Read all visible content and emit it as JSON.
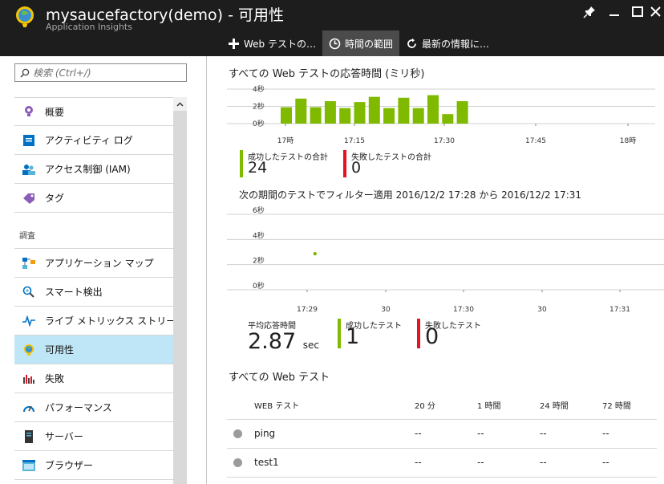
{
  "header": {
    "title": "mysaucefactory(demo) - 可用性",
    "subtitle": "Application Insights",
    "commands": [
      {
        "label": "Web テストの…",
        "icon": "plus-icon"
      },
      {
        "label": "時間の範囲",
        "icon": "clock-icon"
      },
      {
        "label": "最新の情報に…",
        "icon": "refresh-icon"
      }
    ],
    "window_buttons": [
      "pin-icon",
      "minimize-icon",
      "maximize-icon",
      "close-icon"
    ]
  },
  "sidebar": {
    "search_placeholder": "検索 (Ctrl+/)",
    "items": [
      {
        "label": "概要",
        "icon": "lightbulb-icon"
      },
      {
        "label": "アクティビティ ログ",
        "icon": "activity-log-icon"
      },
      {
        "label": "アクセス制御 (IAM)",
        "icon": "users-icon"
      },
      {
        "label": "タグ",
        "icon": "tag-icon"
      }
    ],
    "section_label": "調査",
    "section_items": [
      {
        "label": "アプリケーション マップ",
        "icon": "app-map-icon"
      },
      {
        "label": "スマート検出",
        "icon": "smart-detection-icon"
      },
      {
        "label": "ライブ メトリックス ストリーム",
        "icon": "live-metrics-icon"
      },
      {
        "label": "可用性",
        "icon": "globe-icon"
      },
      {
        "label": "失敗",
        "icon": "failures-chart-icon"
      },
      {
        "label": "パフォーマンス",
        "icon": "performance-icon"
      },
      {
        "label": "サーバー",
        "icon": "server-icon"
      },
      {
        "label": "ブラウザー",
        "icon": "browser-icon"
      }
    ]
  },
  "main": {
    "response_chart_title": "すべての Web テストの応答時間 (ミリ秒)",
    "totals": {
      "passed_label": "成功したテストの合計",
      "passed_value": "24",
      "failed_label": "失敗したテストの合計",
      "failed_value": "0"
    },
    "filter_text": "次の期間のテストでフィルター適用 2016/12/2 17:28 から 2016/12/2 17:31",
    "period": {
      "avg_label": "平均応答時間",
      "avg_value": "2.87",
      "avg_unit": "sec",
      "passed_label": "成功したテスト",
      "passed_value": "1",
      "failed_label": "失敗したテスト",
      "failed_value": "0"
    },
    "web_tests_title": "すべての Web テスト",
    "table": {
      "headers": [
        "WEB テスト",
        "20 分",
        "1 時間",
        "24 時間",
        "72 時間"
      ],
      "rows": [
        {
          "name": "ping",
          "cells": [
            "--",
            "--",
            "--",
            "--"
          ]
        },
        {
          "name": "test1",
          "cells": [
            "--",
            "--",
            "--",
            "--"
          ]
        }
      ]
    },
    "colors": {
      "success": "#7fba00",
      "failure": "#e81123",
      "active": "#bfe6f7",
      "header": "#1d1d1d"
    }
  },
  "chart_data": [
    {
      "type": "bar",
      "title": "すべての Web テストの応答時間 (ミリ秒)",
      "y_ticks": [
        "4秒",
        "2秒",
        "0秒"
      ],
      "ylim": [
        0,
        4
      ],
      "x_ticks": [
        "17時",
        "17:15",
        "17:30",
        "17:45",
        "18時"
      ],
      "values": [
        1.9,
        2.9,
        1.9,
        2.6,
        1.8,
        2.5,
        3.1,
        1.8,
        3.0,
        1.8,
        3.3,
        1.1,
        2.6
      ],
      "color": "#7fba00",
      "grid": true
    },
    {
      "type": "scatter",
      "y_ticks": [
        "6秒",
        "4秒",
        "2秒",
        "0秒"
      ],
      "ylim": [
        0,
        6
      ],
      "x_ticks": [
        "17:29",
        "30",
        "17:30",
        "30",
        "17:31"
      ],
      "points": [
        {
          "x": 0.1,
          "y": 2.87
        }
      ],
      "color": "#7fba00",
      "grid": true
    }
  ]
}
